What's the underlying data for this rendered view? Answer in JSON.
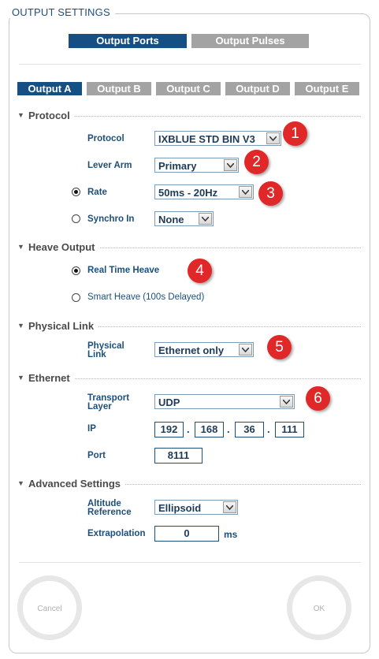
{
  "window": {
    "title": "OUTPUT SETTINGS"
  },
  "top_tabs": [
    {
      "label": "Output Ports",
      "active": true
    },
    {
      "label": "Output Pulses",
      "active": false
    }
  ],
  "output_tabs": [
    {
      "label": "Output A",
      "active": true
    },
    {
      "label": "Output B",
      "active": false
    },
    {
      "label": "Output C",
      "active": false
    },
    {
      "label": "Output D",
      "active": false
    },
    {
      "label": "Output E",
      "active": false
    }
  ],
  "protocol_section": {
    "title": "Protocol",
    "protocol_label": "Protocol",
    "protocol_value": "IXBLUE STD BIN V3",
    "lever_arm_label": "Lever Arm",
    "lever_arm_value": "Primary",
    "rate_label": "Rate",
    "rate_value": "50ms - 20Hz",
    "rate_selected": true,
    "synchro_label": "Synchro In",
    "synchro_value": "None",
    "synchro_selected": false
  },
  "heave_section": {
    "title": "Heave Output",
    "real_time_label": "Real Time Heave",
    "real_time_selected": true,
    "smart_label": "Smart Heave (100s Delayed)",
    "smart_selected": false
  },
  "physical_section": {
    "title": "Physical Link",
    "label_line1": "Physical",
    "label_line2": "Link",
    "value": "Ethernet only"
  },
  "ethernet_section": {
    "title": "Ethernet",
    "transport_line1": "Transport",
    "transport_line2": "Layer",
    "transport_value": "UDP",
    "ip_label": "IP",
    "ip": [
      "192",
      "168",
      "36",
      "111"
    ],
    "ip_separator": ".",
    "port_label": "Port",
    "port_value": "8111"
  },
  "advanced_section": {
    "title": "Advanced Settings",
    "altitude_line1": "Altitude",
    "altitude_line2": "Reference",
    "altitude_value": "Ellipsoid",
    "extrapolation_label": "Extrapolation",
    "extrapolation_value": "0",
    "extrapolation_unit": "ms"
  },
  "annotations": [
    "1",
    "2",
    "3",
    "4",
    "5",
    "6"
  ],
  "buttons": {
    "cancel": "Cancel",
    "ok": "OK"
  },
  "colors": {
    "accent": "#154f84",
    "tab_inactive": "#a3a3a3",
    "label_text": "#1d4f7c",
    "badge": "#e02828"
  },
  "icons": {
    "dropdown": "chevron-down-icon",
    "section_toggle": "triangle-down-icon"
  }
}
